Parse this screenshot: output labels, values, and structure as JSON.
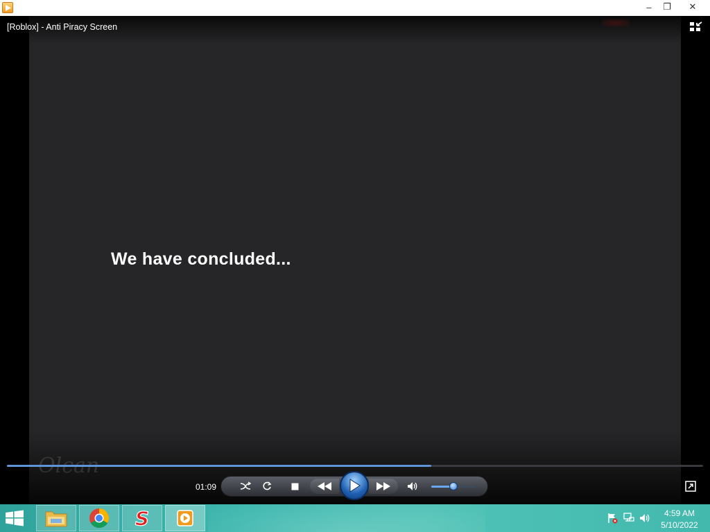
{
  "window": {
    "min_glyph": "–",
    "max_glyph": "❐",
    "close_glyph": "✕"
  },
  "player": {
    "media_title": "[Roblox] - Anti Piracy Screen",
    "video_text": "We have concluded...",
    "watermark_text": "Olcan",
    "time_elapsed": "01:09",
    "seek_progress_fraction": 0.61,
    "volume_fraction": 0.5,
    "state": "paused"
  },
  "taskbar": {
    "items": [
      {
        "name": "File Explorer",
        "icon": "folder-icon"
      },
      {
        "name": "Google Chrome",
        "icon": "chrome-icon"
      },
      {
        "name": "S app",
        "icon": "s-logo-icon"
      },
      {
        "name": "Media Player",
        "icon": "media-player-icon"
      }
    ],
    "clock_time": "4:59 AM",
    "clock_date": "5/10/2022"
  },
  "colors": {
    "video_background": "#262628",
    "seek_fill": "#5e95d8",
    "taskbar": "#3cb7ae"
  }
}
